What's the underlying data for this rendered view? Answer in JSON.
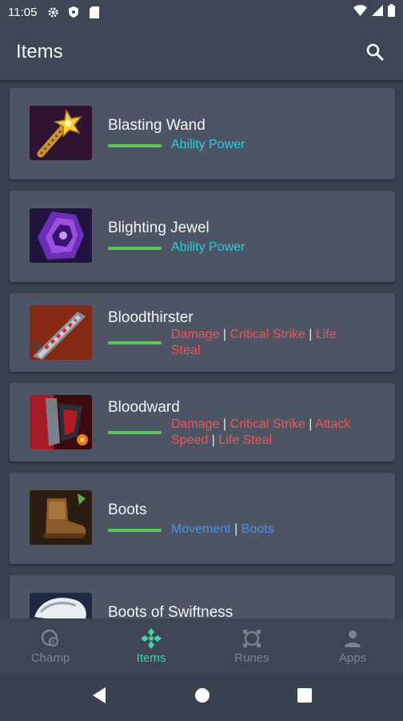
{
  "status_bar": {
    "time": "11:05",
    "icons_left": [
      "gear-icon",
      "shield-icon",
      "sd-card-icon"
    ],
    "icons_right": [
      "wifi-icon",
      "signal-icon",
      "battery-icon"
    ]
  },
  "app_bar": {
    "title": "Items",
    "search_icon": "search-icon"
  },
  "items": [
    {
      "name": "Blasting Wand",
      "tags": [
        {
          "text": "Ability Power",
          "color": "cyan"
        }
      ]
    },
    {
      "name": "Blighting Jewel",
      "tags": [
        {
          "text": "Ability Power",
          "color": "cyan"
        }
      ]
    },
    {
      "name": "Bloodthirster",
      "tags": [
        {
          "text": "Damage",
          "color": "red"
        },
        {
          "text": "Critical Strike",
          "color": "red"
        },
        {
          "text": "Life Steal",
          "color": "red"
        }
      ]
    },
    {
      "name": "Bloodward",
      "tags": [
        {
          "text": "Damage",
          "color": "red"
        },
        {
          "text": "Critical Strike",
          "color": "red"
        },
        {
          "text": "Attack Speed",
          "color": "red"
        },
        {
          "text": "Life Steal",
          "color": "red"
        }
      ]
    },
    {
      "name": "Boots",
      "tags": [
        {
          "text": "Movement",
          "color": "blue"
        },
        {
          "text": "Boots",
          "color": "blue"
        }
      ]
    },
    {
      "name": "Boots of Swiftness",
      "tags": []
    }
  ],
  "bottom_nav": [
    {
      "label": "Champ",
      "icon": "champ-icon",
      "active": false
    },
    {
      "label": "Items",
      "icon": "items-icon",
      "active": true
    },
    {
      "label": "Runes",
      "icon": "runes-icon",
      "active": false
    },
    {
      "label": "Apps",
      "icon": "person-icon",
      "active": false
    }
  ],
  "colors": {
    "background": "#3a4150",
    "card": "#4d5464",
    "accent": "#3fd6a6",
    "bar": "#5cc35a",
    "tag_cyan": "#27d0df",
    "tag_red": "#ef5555",
    "tag_blue": "#4f8ee8"
  }
}
